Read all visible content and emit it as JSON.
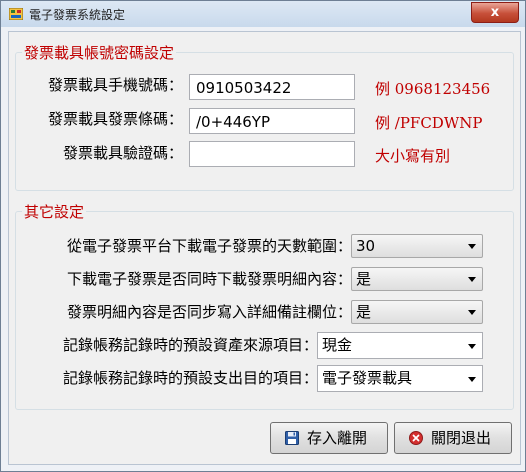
{
  "window": {
    "title": "電子發票系統設定",
    "close_glyph": "x"
  },
  "carrier_group": {
    "legend": "發票載具帳號密碼設定",
    "phone_label": "發票載具手機號碼：",
    "phone_value": "0910503422",
    "phone_hint": "例 0968123456",
    "barcode_label": "發票載具發票條碼：",
    "barcode_value": "/0+446YP",
    "barcode_hint": "例 /PFCDWNP",
    "verify_label": "發票載具驗證碼：",
    "verify_value": "",
    "verify_hint": "大小寫有別"
  },
  "other_group": {
    "legend": "其它設定",
    "days_label": "從電子發票平台下載電子發票的天數範圍：",
    "days_value": "30",
    "detail_label": "下載電子發票是否同時下載發票明細內容：",
    "detail_value": "是",
    "sync_label": "發票明細內容是否同步寫入詳細備註欄位：",
    "sync_value": "是",
    "asset_label": "記錄帳務記錄時的預設資產來源項目：",
    "asset_value": "現金",
    "expense_label": "記錄帳務記錄時的預設支出目的項目：",
    "expense_value": "電子發票載具"
  },
  "buttons": {
    "save": "存入離開",
    "close": "關閉退出"
  },
  "icons": {
    "app": "app-icon",
    "save": "floppy-disk-icon",
    "close": "red-x-circle-icon"
  },
  "colors": {
    "accent_red": "#c00000"
  }
}
